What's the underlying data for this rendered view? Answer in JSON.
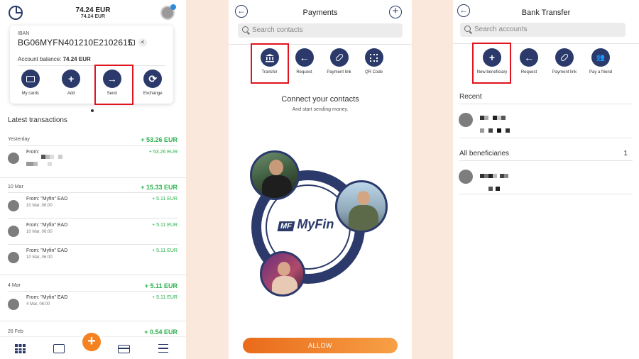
{
  "dashboard": {
    "balance_top": "74.24 EUR",
    "balance_sub": "74.24 EUR",
    "iban_label": "IBAN",
    "iban": "BG06MYFN401210E2102615",
    "account_balance_label": "Account balance:",
    "account_balance_value": "74.24 EUR",
    "actions": [
      {
        "label": "My cards",
        "icon": "card-icon"
      },
      {
        "label": "Add",
        "icon": "plus-icon"
      },
      {
        "label": "Send",
        "icon": "arrow-right-icon"
      },
      {
        "label": "Exchange",
        "icon": "exchange-icon"
      }
    ],
    "latest_title": "Latest transactions",
    "groups": [
      {
        "day": "Yesterday",
        "total": "+ 53.26 EUR",
        "items": [
          {
            "from": "From:",
            "date": "",
            "amount": "+ 53.26 EUR"
          }
        ]
      },
      {
        "day": "10 Mar",
        "total": "+ 15.33 EUR",
        "items": [
          {
            "from": "From: \"Myfin\" EAD",
            "date": "10 Mar, 06:00",
            "amount": "+ 5.11 EUR"
          },
          {
            "from": "From: \"Myfin\" EAD",
            "date": "10 Mar, 06:00",
            "amount": "+ 5.11 EUR"
          },
          {
            "from": "From: \"Myfin\" EAD",
            "date": "10 Mar, 06:00",
            "amount": "+ 5.11 EUR"
          }
        ]
      },
      {
        "day": "4 Mar",
        "total": "+ 5.11 EUR",
        "items": [
          {
            "from": "From: \"Myfin\" EAD",
            "date": "4 Mar, 06:00",
            "amount": "+ 5.11 EUR"
          }
        ]
      },
      {
        "day": "26 Feb",
        "total": "+ 0.54 EUR",
        "items": []
      }
    ]
  },
  "payments": {
    "title": "Payments",
    "search_placeholder": "Search contacts",
    "actions": [
      {
        "label": "Transfer",
        "icon": "bank-icon"
      },
      {
        "label": "Request",
        "icon": "arrow-left-icon"
      },
      {
        "label": "Payment link",
        "icon": "link-icon"
      },
      {
        "label": "QR Code",
        "icon": "qr-icon"
      }
    ],
    "connect_title": "Connect your contacts",
    "connect_sub": "And start sending money.",
    "logo_text": "MyFin",
    "logo_mark": "MF",
    "allow_label": "ALLOW"
  },
  "bank_transfer": {
    "title": "Bank Transfer",
    "search_placeholder": "Search accounts",
    "actions": [
      {
        "label": "New beneficiary",
        "icon": "plus-icon"
      },
      {
        "label": "Request",
        "icon": "arrow-left-icon"
      },
      {
        "label": "Payment link",
        "icon": "link-icon"
      },
      {
        "label": "Pay a friend",
        "icon": "people-icon"
      }
    ],
    "recent_label": "Recent",
    "all_label": "All beneficiaries",
    "all_count": "1"
  },
  "colors": {
    "navy": "#2b3a6b",
    "green": "#2bb24c",
    "orange": "#f58220",
    "highlight": "#e0141e"
  }
}
